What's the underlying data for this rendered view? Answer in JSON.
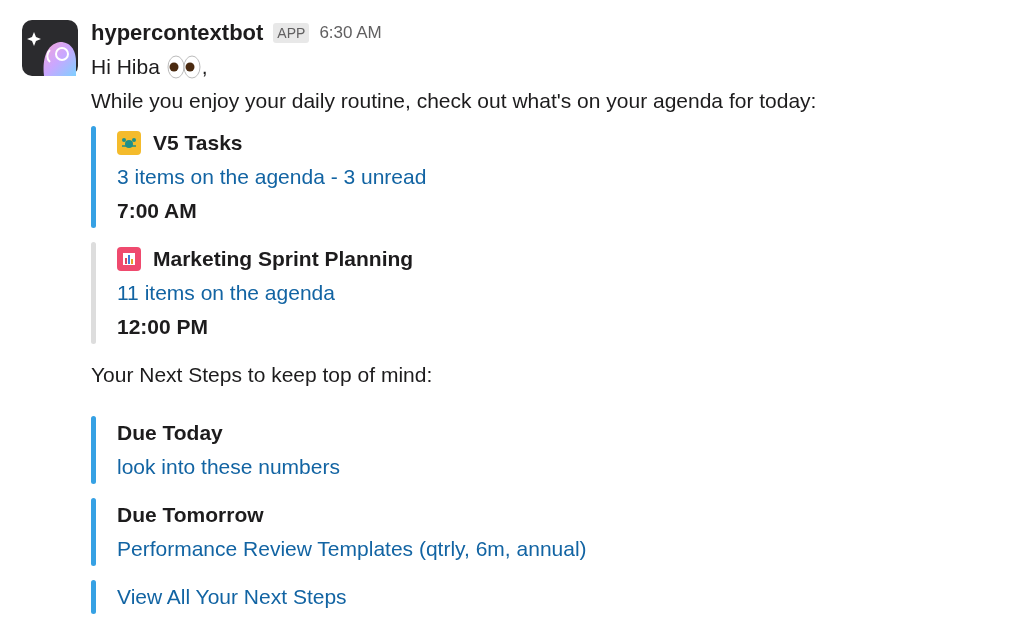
{
  "message": {
    "sender": "hypercontextbot",
    "badge": "APP",
    "time": "6:30 AM",
    "greeting": "Hi Hiba",
    "greeting_end": ",",
    "intro": "While you enjoy your daily routine, check out what's on your agenda for today:"
  },
  "meetings": [
    {
      "title": "V5 Tasks",
      "link": "3 items on the agenda - 3 unread",
      "time": "7:00 AM",
      "color": "#36a1e4"
    },
    {
      "title": "Marketing Sprint Planning",
      "link": "11 items on the agenda",
      "time": "12:00 PM",
      "color": "#dddddd"
    }
  ],
  "next_steps_heading": "Your Next Steps to keep top of mind:",
  "next_steps": [
    {
      "label": "Due Today",
      "link": "look into these numbers"
    },
    {
      "label": "Due Tomorrow",
      "link": "Performance Review Templates (qtrly, 6m, annual)"
    }
  ],
  "view_all": "View All Your Next Steps"
}
